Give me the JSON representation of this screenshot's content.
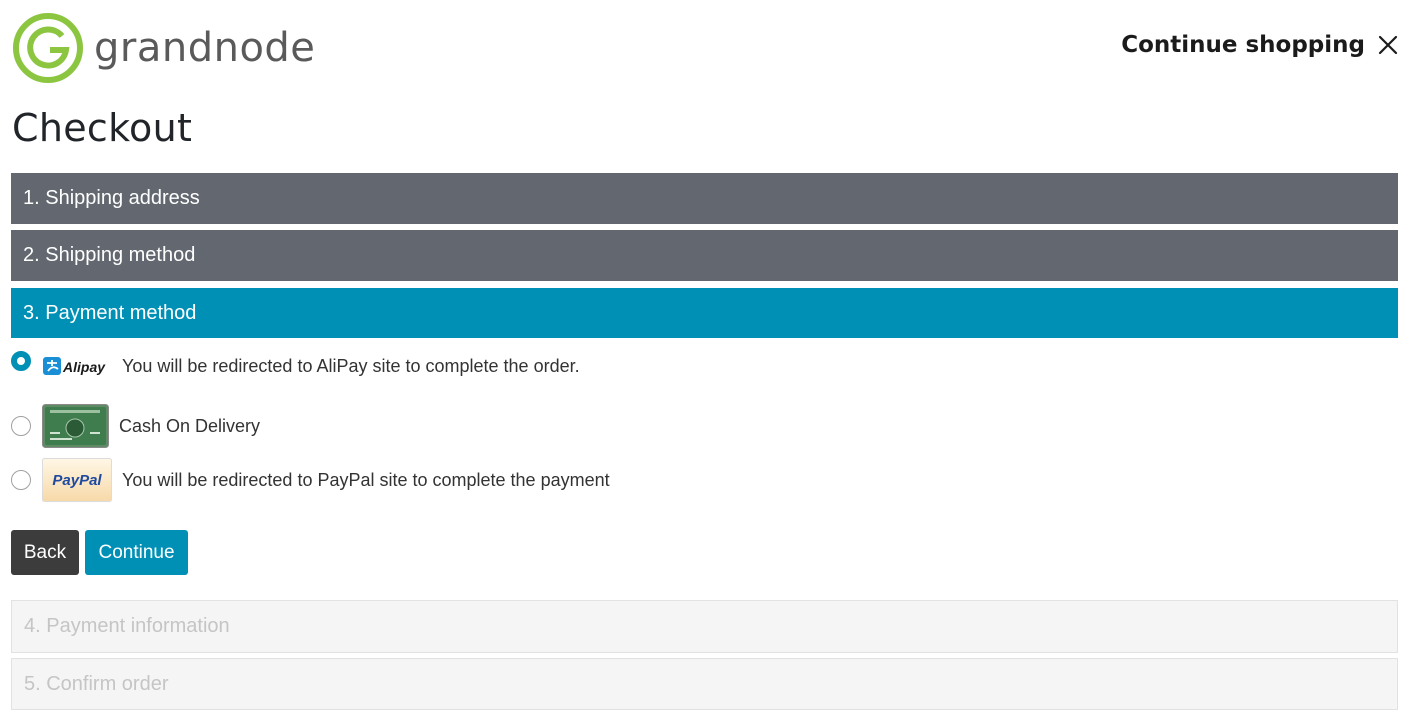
{
  "brand": {
    "name": "grandnode",
    "logo_color": "#8cc540"
  },
  "header": {
    "continue_shopping_label": "Continue shopping",
    "close_icon": "close-icon"
  },
  "page": {
    "title": "Checkout"
  },
  "colors": {
    "accent": "#0090b5",
    "step_done": "#636870",
    "step_pending": "#f5f5f5",
    "back_button": "#3c3c3c"
  },
  "steps": [
    {
      "label": "1. Shipping address",
      "state": "done"
    },
    {
      "label": "2. Shipping method",
      "state": "done"
    },
    {
      "label": "3. Payment method",
      "state": "active"
    },
    {
      "label": "4. Payment information",
      "state": "pending"
    },
    {
      "label": "5. Confirm order",
      "state": "pending"
    }
  ],
  "payment_methods": [
    {
      "logo_text": "Alipay",
      "description": "You will be redirected to AliPay site to complete the order.",
      "selected": true,
      "icon": "alipay-logo-icon"
    },
    {
      "logo_text": "",
      "description": "Cash On Delivery",
      "selected": false,
      "icon": "credit-card-icon"
    },
    {
      "logo_text": "PayPal",
      "description": "You will be redirected to PayPal site to complete the payment",
      "selected": false,
      "icon": "paypal-logo-icon"
    }
  ],
  "buttons": {
    "back": "Back",
    "continue": "Continue"
  }
}
